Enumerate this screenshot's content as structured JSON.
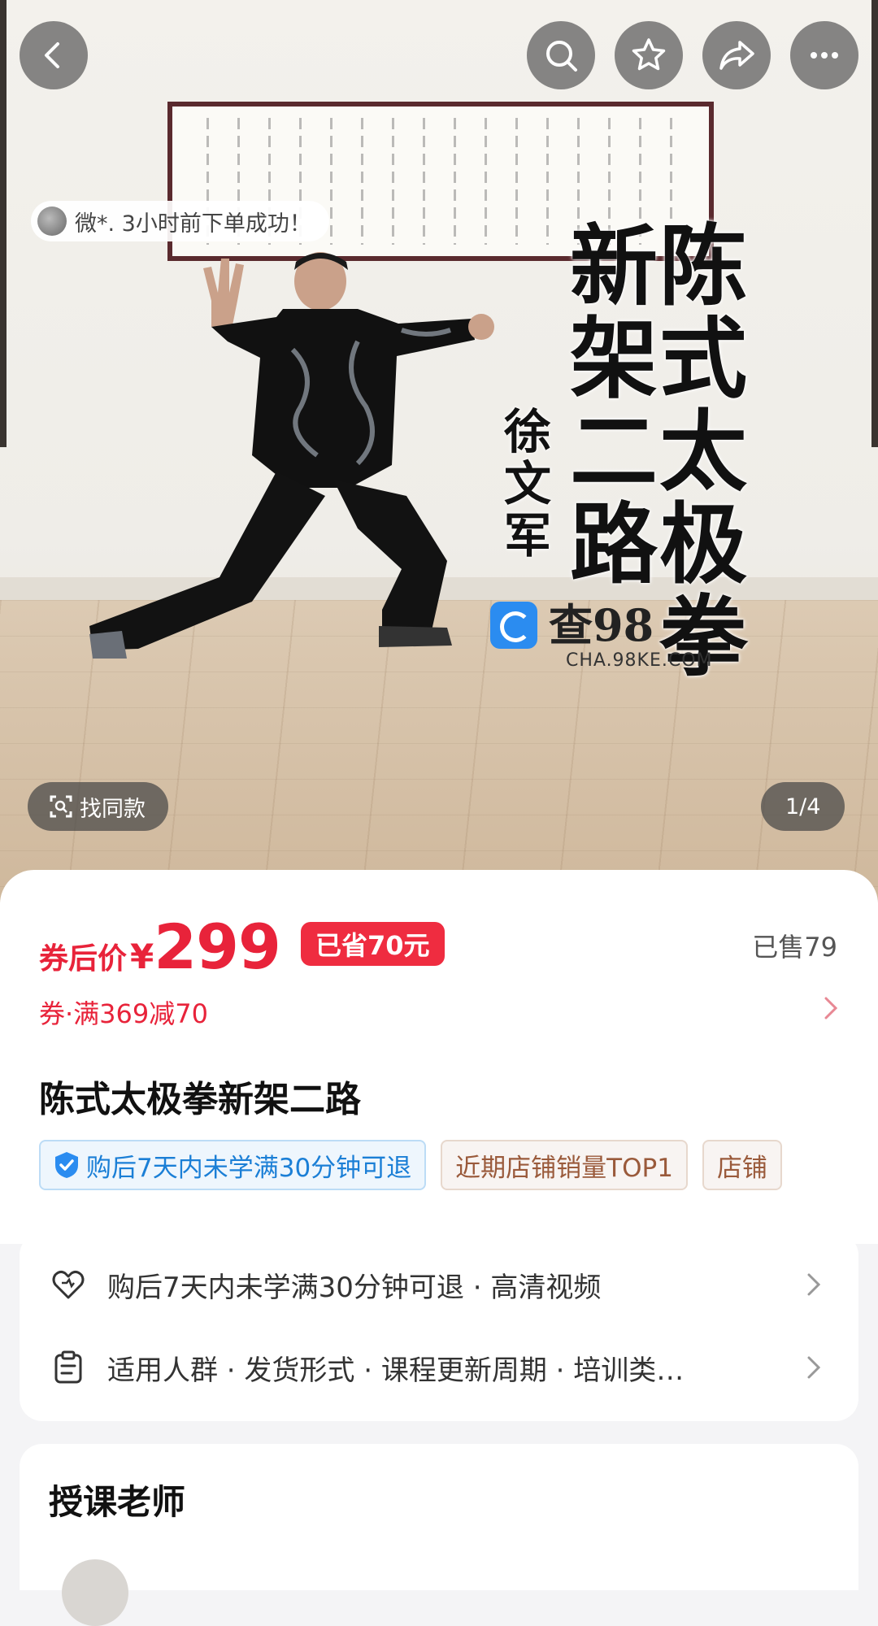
{
  "hero": {
    "toast": "微*. 3小时前下单成功！",
    "calligraphy_col1": "陈式太极拳",
    "calligraphy_col2": "新架二路",
    "calligraphy_author": "徐文军",
    "watermark_text": "查98",
    "watermark_url": "CHA.98KE.COM",
    "find_similar": "找同款",
    "page_indicator": "1/4"
  },
  "topbar": {
    "back_icon": "chevron-left-icon",
    "search_icon": "search-icon",
    "favorite_icon": "star-icon",
    "share_icon": "share-icon",
    "more_icon": "more-icon"
  },
  "price": {
    "label": "券后价",
    "currency": "¥",
    "value": "299",
    "saved": "已省70元",
    "sold": "已售79",
    "coupon": "券·满369减70"
  },
  "product": {
    "title": "陈式太极拳新架二路",
    "tags": [
      {
        "label": "购后7天内未学满30分钟可退",
        "style": "blue"
      },
      {
        "label": "近期店铺销量TOP1",
        "style": "brown"
      },
      {
        "label": "店铺",
        "style": "brown"
      }
    ]
  },
  "service": {
    "rows": [
      {
        "icon": "heart-shield-icon",
        "label": "购后7天内未学满30分钟可退 · 高清视频"
      },
      {
        "icon": "clipboard-icon",
        "label": "适用人群 · 发货形式 · 课程更新周期 · 培训类…"
      }
    ]
  },
  "teacher": {
    "title": "授课老师"
  },
  "colors": {
    "accent_red": "#e8233a",
    "tag_blue": "#1b7fd6",
    "tag_brown": "#9a5a3b"
  }
}
